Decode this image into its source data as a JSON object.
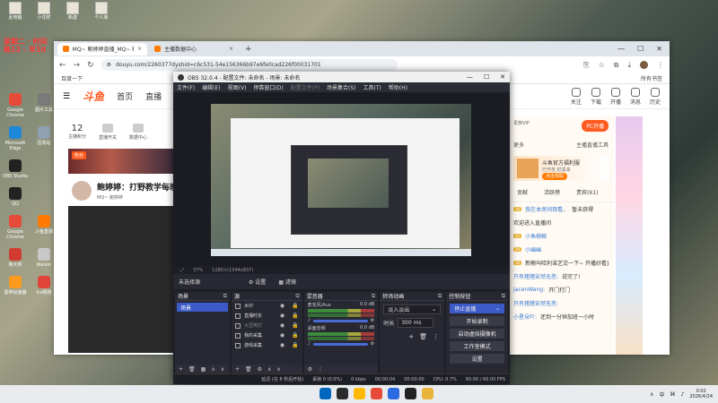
{
  "desktop": {
    "top_icons": [
      "此电脑",
      "小花样",
      "新建",
      "个人库"
    ],
    "dateline": [
      "星期二 · 时间",
      "晚12 - 早10"
    ],
    "icons": [
      {
        "label": "Google Chrome",
        "color": "#e84a3a"
      },
      {
        "label": "图片工具",
        "color": "#7a7a7a"
      },
      {
        "label": "Microsoft Edge",
        "color": "#1e88d8"
      },
      {
        "label": "回收站",
        "color": "#8fa0b0"
      },
      {
        "label": "OBS Studio",
        "color": "#222222"
      },
      {
        "label": "",
        "color": "#00000000"
      },
      {
        "label": "QQ",
        "color": "#222222"
      },
      {
        "label": "",
        "color": "#00000000"
      },
      {
        "label": "Google Chrome",
        "color": "#e84a3a"
      },
      {
        "label": "斗鱼直播",
        "color": "#ff7a00"
      },
      {
        "label": "鲁大师",
        "color": "#d23b2f"
      },
      {
        "label": "Weixin",
        "color": "#c8c8c8"
      },
      {
        "label": "雷神加速器",
        "color": "#ff9a1f"
      },
      {
        "label": "Ico网游",
        "color": "#e0453a"
      }
    ]
  },
  "browser": {
    "tabs": [
      {
        "label": "MQ~ 鲍婷婷直播_MQ~ 鲍婷婷视频...",
        "active": true
      },
      {
        "label": "主播数据中心",
        "active": false
      }
    ],
    "url": "douyu.com/2260377dyshid=c6c531-54e156366b97e6fe0cad226f00031701",
    "bookmark": "百度一下",
    "all_bookmarks": "所有书签",
    "nav": {
      "logo": "斗鱼",
      "links": [
        "首页",
        "直播"
      ]
    },
    "nav_right": [
      "关注",
      "下载",
      "开播",
      "消息",
      "历史"
    ],
    "stats": [
      {
        "num": "12",
        "label": "主播积分"
      },
      {
        "label": "直播开关"
      },
      {
        "label": "数据中心"
      }
    ],
    "banner_tag": "粉丝",
    "streamer_title": "鲍婷婷：打野教学每晚",
    "streamer_sub": "MQ~ 鲍婷婷",
    "right_panel": {
      "top_left": "贵族VIP",
      "pc_button": "PC开播",
      "promo": "主播直播工具",
      "row": [
        "更多"
      ],
      "card_title": "斗鱼官方福利服",
      "card_sub": "已开放 赶紧来",
      "card_btn": "点击领取",
      "tabs": [
        "贡献",
        "活跃榜",
        "贵宾(61)"
      ],
      "chat": [
        {
          "badge": "16",
          "name": "我在本房间观看，",
          "text": "暂未获得"
        },
        {
          "badge": "",
          "name": "",
          "text": "欢迎进入直播间"
        },
        {
          "badge": "25",
          "name": "小鱼柳鲸",
          "text": ""
        },
        {
          "badge": "29",
          "name": "小幽幽",
          "text": ""
        },
        {
          "badge": "19",
          "name": "",
          "text": "新鲍叫哈利诺艺交一下~ 开播好看直播上12点"
        },
        {
          "badge": "",
          "name": "只有猪猪安然无恙:",
          "text": "说完了!"
        },
        {
          "badge": "",
          "name": "JacenWang:",
          "text": "开门打门"
        },
        {
          "badge": "",
          "name": "只有猪猪安然无恙:",
          "text": ""
        },
        {
          "badge": "",
          "name": "小星朵吖:",
          "text": "还到一分钟加班一小时"
        }
      ]
    }
  },
  "obs": {
    "title": "OBS 32.0.4 - 配置文件: 未命名 - 场景: 未命名",
    "menu": [
      "文件(F)",
      "编辑(E)",
      "视图(V)",
      "停靠窗口(D)",
      "配置文件(P)",
      "场景集合(S)",
      "工具(T)",
      "帮助(H)"
    ],
    "menu_disabled_index": 4,
    "preview_zoom": "37%",
    "preview_size": "1280×(1344x837)",
    "toolbar": [
      "未选择源",
      "⚙ 设置",
      "▦ 滤镜"
    ],
    "docks": {
      "scenes": {
        "title": "场景",
        "items": [
          "场景"
        ]
      },
      "sources": {
        "title": "源",
        "items": [
          {
            "label": "水印",
            "faded": false
          },
          {
            "label": "直播时长",
            "faded": false
          },
          {
            "label": "大豆鸭打",
            "faded": true
          },
          {
            "label": "我的采集",
            "faded": false
          },
          {
            "label": "游戏采集",
            "faded": false
          }
        ]
      },
      "mixer": {
        "title": "混音器",
        "channels": [
          {
            "name": "麦克风/Aux",
            "db": "0.0 dB"
          },
          {
            "name": "桌面音频",
            "db": "0.0 dB"
          }
        ]
      },
      "transitions": {
        "title": "转场动画",
        "type": "淡入淡出",
        "duration_label": "时长",
        "duration": "300 ms"
      },
      "controls": {
        "title": "控制按钮",
        "buttons": [
          "停止直播",
          "开始录制",
          "启动虚拟摄像机",
          "工作室模式",
          "设置"
        ]
      }
    },
    "status": [
      "延迟 (在 8 秒后开始)",
      "丢帧 0 (0.0%)",
      "0 kbps",
      "00:00:04",
      "00:00:00",
      "CPU: 0.7%",
      "60.00 / 60.00 FPS"
    ]
  },
  "taskbar": {
    "tray_lang": "中",
    "time": "0:02",
    "date": "2026/4/24",
    "colors": [
      "#0067c0",
      "#2b2b2b",
      "#ffb900",
      "#e84a3a",
      "#2b6ae0",
      "#222222",
      "#e9b43a"
    ]
  }
}
